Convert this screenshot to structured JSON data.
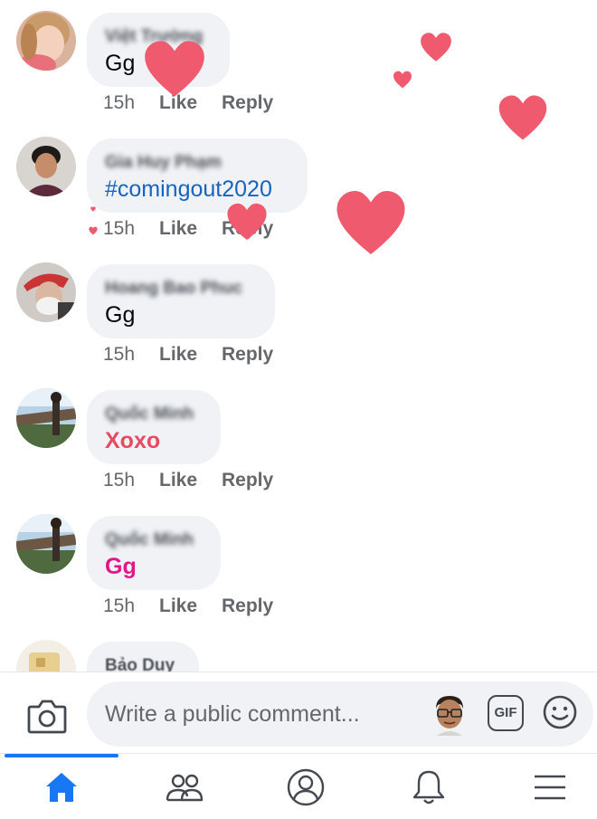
{
  "comments": [
    {
      "author": "Việt Trường",
      "text": "Gg",
      "time": "15h",
      "like": "Like",
      "reply": "Reply"
    },
    {
      "author": "Gia Huy Phạm",
      "text": "#comingout2020",
      "time": "15h",
      "like": "Like",
      "reply": "Reply"
    },
    {
      "author": "Hoang Bao Phuc",
      "text": "Gg",
      "time": "15h",
      "like": "Like",
      "reply": "Reply"
    },
    {
      "author": "Quốc Minh",
      "text": "Xoxo",
      "time": "15h",
      "like": "Like",
      "reply": "Reply"
    },
    {
      "author": "Quốc Minh",
      "text": "Gg",
      "time": "15h",
      "like": "Like",
      "reply": "Reply"
    },
    {
      "author": "Bảo Duy",
      "text": "",
      "time": "",
      "like": "",
      "reply": ""
    }
  ],
  "composer": {
    "placeholder": "Write a public comment...",
    "gif_label": "GIF",
    "icons": [
      "camera-icon",
      "memoji-avatar",
      "gif-icon",
      "emoji-icon"
    ]
  },
  "tabs": [
    {
      "name": "home",
      "icon": "home-icon",
      "active": true
    },
    {
      "name": "friends",
      "icon": "friends-icon",
      "active": false
    },
    {
      "name": "profile",
      "icon": "profile-icon",
      "active": false
    },
    {
      "name": "notifications",
      "icon": "bell-icon",
      "active": false
    },
    {
      "name": "menu",
      "icon": "menu-icon",
      "active": false
    }
  ],
  "colors": {
    "accent": "#1877f2",
    "bubble": "#f0f2f5",
    "heart": "#f05a6e",
    "hashtag": "#1565c0",
    "xoxo": "#e64b63",
    "gg_magenta": "#e4148d"
  }
}
